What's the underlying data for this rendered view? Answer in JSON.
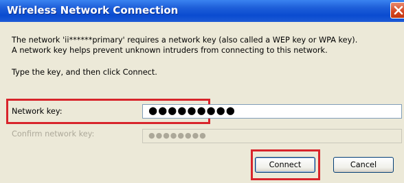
{
  "window": {
    "title": "Wireless Network Connection"
  },
  "message": {
    "line1": "The network 'ii******primary' requires a network key (also called a WEP key or WPA key).",
    "line2": "A network key helps prevent unknown intruders from connecting to this network.",
    "instruction": "Type the key, and then click Connect."
  },
  "form": {
    "network_key_label": "Network key:",
    "network_key_value": "●●●●●●●●●",
    "confirm_key_label": "Confirm network key:",
    "confirm_key_value": "●●●●●●●●"
  },
  "buttons": {
    "connect": "Connect",
    "cancel": "Cancel"
  },
  "colors": {
    "highlight": "#d8242b",
    "title_bar": "#0a4bd0"
  }
}
